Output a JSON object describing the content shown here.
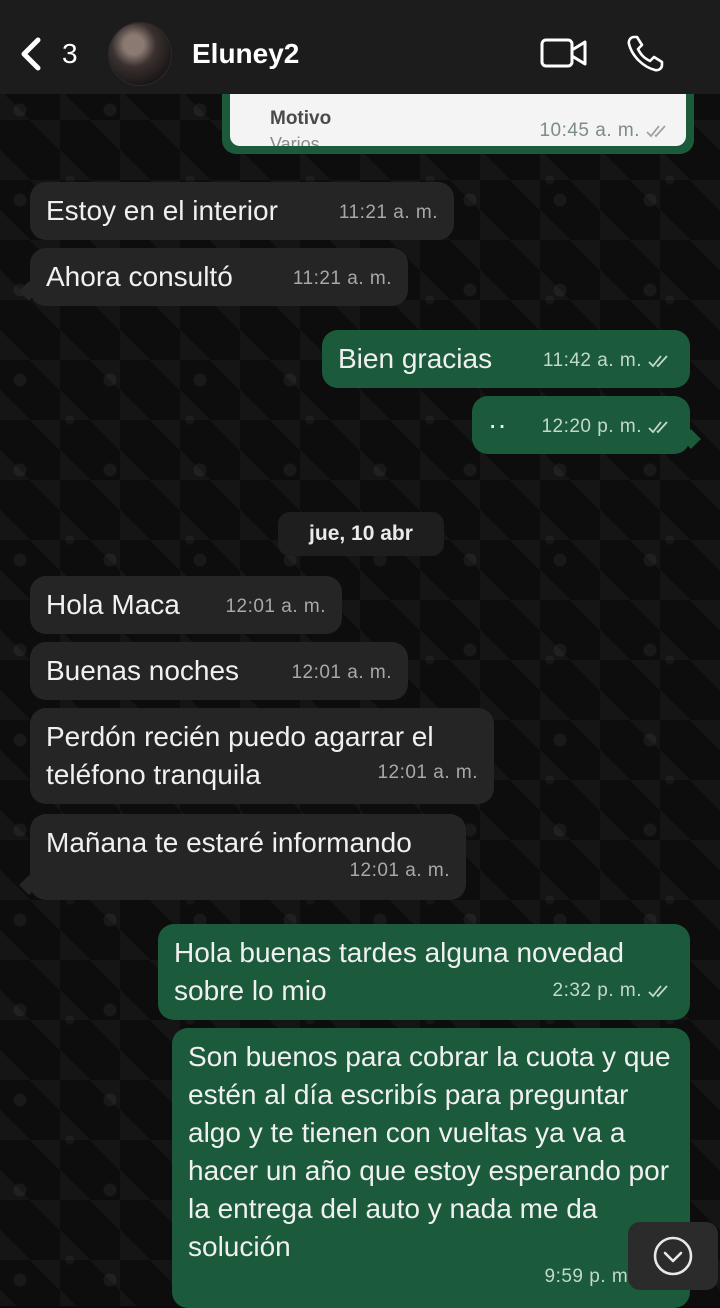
{
  "header": {
    "back_count": "3",
    "contact_name": "Eluney2",
    "icons": [
      "chevron-left-icon",
      "video-call-icon",
      "phone-icon"
    ]
  },
  "quoted_card": {
    "label": "Motivo",
    "value": "Varios",
    "time": "10:45 a. m."
  },
  "messages_before": [
    {
      "side": "in",
      "text": "Estoy en el interior",
      "time": "11:21 a. m."
    },
    {
      "side": "in",
      "text": "Ahora consultó",
      "time": "11:21 a. m."
    },
    {
      "side": "out",
      "text": "Bien gracias",
      "time": "11:42 a. m."
    },
    {
      "side": "out",
      "text": "··",
      "time": "12:20 p. m."
    }
  ],
  "date_separator": "jue, 10 abr",
  "messages_after": [
    {
      "side": "in",
      "text": "Hola Maca",
      "time": "12:01 a. m."
    },
    {
      "side": "in",
      "text": "Buenas noches",
      "time": "12:01 a. m."
    },
    {
      "side": "in",
      "text": "Perdón recién puedo agarrar el teléfono tranquila",
      "time": "12:01 a. m."
    },
    {
      "side": "in",
      "text": "Mañana te estaré informando",
      "time": "12:01 a. m."
    },
    {
      "side": "out",
      "text": "Hola buenas tardes alguna novedad sobre lo mio",
      "time": "2:32 p. m."
    },
    {
      "side": "out",
      "text": "Son buenos para cobrar la cuota y que estén al día escribís para preguntar algo y te tienen con vueltas ya va a hacer un año que estoy esperando por la entrega del auto y nada me da solución",
      "time": "9:59 p. m."
    }
  ],
  "colors": {
    "header_bg": "#1c1c1c",
    "incoming_bubble": "#252525",
    "outgoing_bubble": "#1b5b3c",
    "tick_color": "#c2d8cb"
  }
}
